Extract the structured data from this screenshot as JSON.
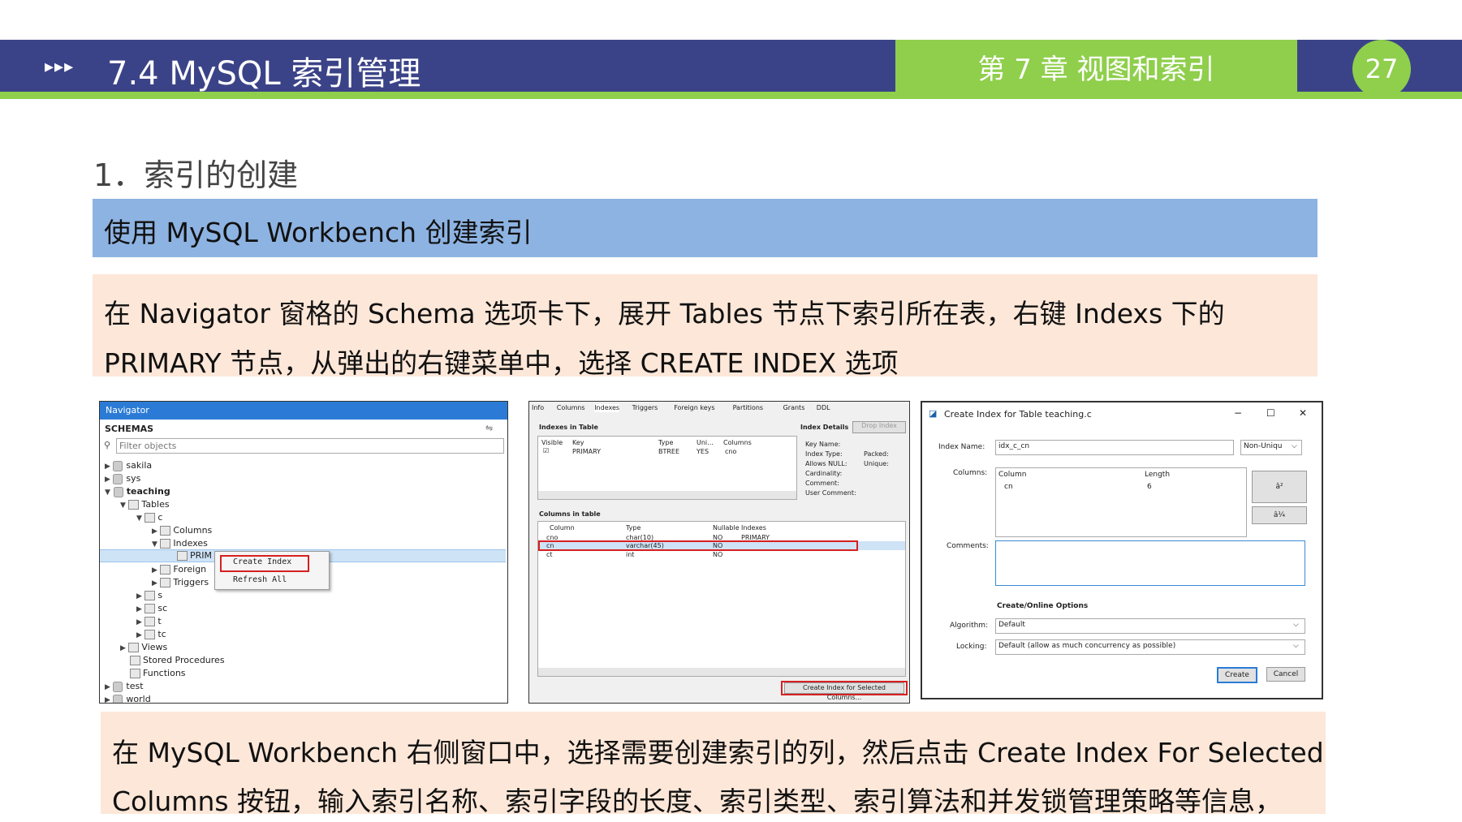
{
  "header": {
    "arrows": "▸▸▸",
    "title": "7.4  MySQL 索引管理",
    "chapter": "第 7 章   视图和索引",
    "page_number": "27"
  },
  "section": {
    "title": "1．索引的创建",
    "band": "使用 MySQL Workbench 创建索引",
    "para1_line1": "在 Navigator 窗格的 Schema 选项卡下，展开 Tables 节点下索引所在表，右键 Indexs 下的",
    "para1_line2": "PRIMARY 节点，从弹出的右键菜单中，选择 CREATE INDEX 选项",
    "para2_line1": "在 MySQL Workbench 右侧窗口中，选择需要创建索引的列，然后点击 Create Index For Selected",
    "para2_line2": "Columns 按钮，输入索引名称、索引字段的长度、索引类型、索引算法和并发锁管理策略等信息，"
  },
  "navigator": {
    "title": "Navigator",
    "schemas": "SCHEMAS",
    "filter_placeholder": "Filter objects",
    "tree": {
      "sakila": "sakila",
      "sys": "sys",
      "teaching": "teaching",
      "tables": "Tables",
      "c": "c",
      "columns": "Columns",
      "indexes": "Indexes",
      "prim": "PRIM",
      "foreign": "Foreign",
      "triggers": "Triggers",
      "s": "s",
      "sc": "sc",
      "t": "t",
      "tc": "tc",
      "views": "Views",
      "stored_procedures": "Stored Procedures",
      "functions": "Functions",
      "test": "test",
      "world": "world"
    },
    "context_menu": {
      "create_index": "Create Index",
      "refresh_all": "Refresh All"
    }
  },
  "index_editor": {
    "tabs": [
      "Info",
      "Columns",
      "Indexes",
      "Triggers",
      "Foreign keys",
      "Partitions",
      "Grants",
      "DDL"
    ],
    "indexes_in_table": "Indexes in Table",
    "index_details": "Index Details",
    "drop_index": "Drop Index",
    "idx_headers": [
      "Visible",
      "Key",
      "Type",
      "Uni...",
      "Columns"
    ],
    "idx_row": {
      "key": "PRIMARY",
      "type": "BTREE",
      "unique": "YES",
      "columns": "cno"
    },
    "details": {
      "key_name": "Key Name:",
      "index_type": "Index Type:",
      "allows_null": "Allows NULL:",
      "cardinality": "Cardinality:",
      "comment": "Comment:",
      "user_comment": "User Comment:",
      "packed": "Packed:",
      "unique": "Unique:"
    },
    "columns_in_table": "Columns in table",
    "col_headers": [
      "Column",
      "Type",
      "Nullable",
      "Indexes"
    ],
    "col_rows": [
      {
        "column": "cno",
        "type": "char(10)",
        "nullable": "NO",
        "indexes": "PRIMARY"
      },
      {
        "column": "cn",
        "type": "varchar(45)",
        "nullable": "NO",
        "indexes": ""
      },
      {
        "column": "ct",
        "type": "int",
        "nullable": "NO",
        "indexes": ""
      }
    ],
    "create_button": "Create Index for Selected Columns..."
  },
  "create_dialog": {
    "title": "Create Index for Table teaching.c",
    "index_name_label": "Index Name:",
    "index_name_value": "idx_c_cn",
    "index_kind": "Non-Uniqu",
    "columns_label": "Columns:",
    "col_header_column": "Column",
    "col_header_length": "Length",
    "col_value": "cn",
    "length_value": "6",
    "up_button": "â²",
    "down_button": "â¼",
    "comments_label": "Comments:",
    "options_title": "Create/Online Options",
    "algorithm_label": "Algorithm:",
    "algorithm_value": "Default",
    "locking_label": "Locking:",
    "locking_value": "Default (allow as much concurrency as possible)",
    "create_button": "Create",
    "cancel_button": "Cancel",
    "minimize": "−",
    "maximize": "☐",
    "close": "✕"
  }
}
